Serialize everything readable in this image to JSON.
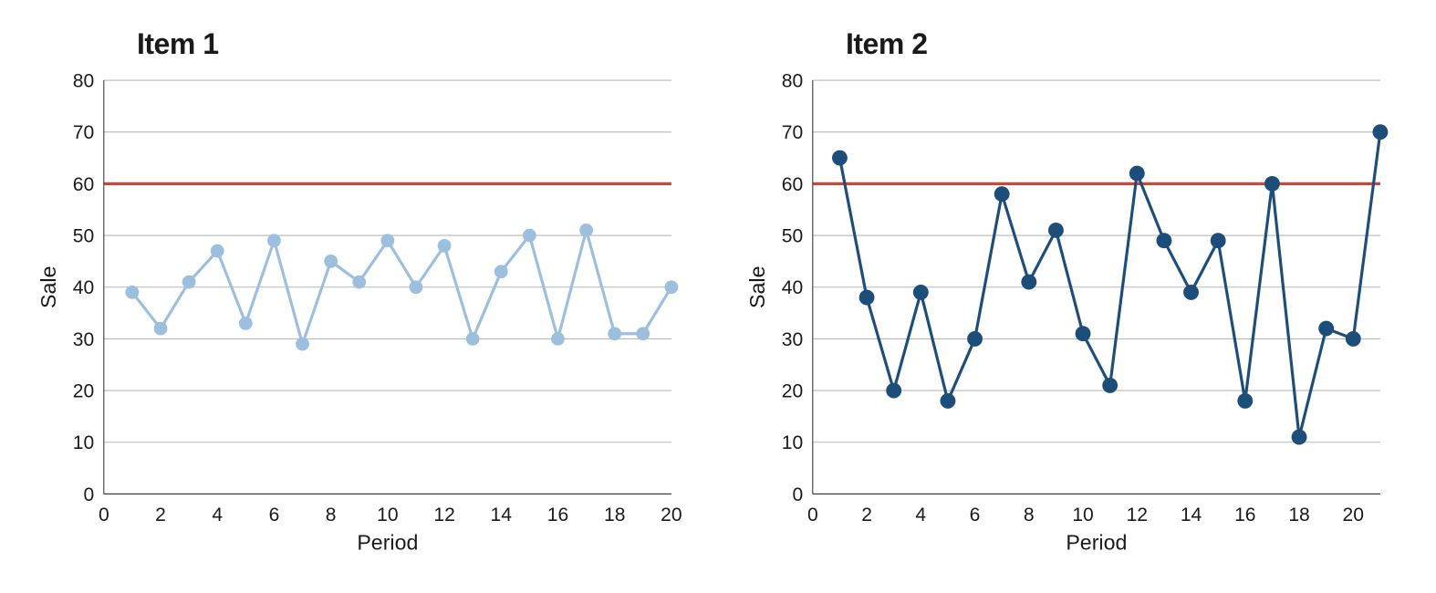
{
  "chart_data": [
    {
      "type": "line",
      "title": "Item 1",
      "xlabel": "Period",
      "ylabel": "Sale",
      "xlim": [
        0,
        20
      ],
      "ylim": [
        0,
        80
      ],
      "x_ticks": [
        0,
        2,
        4,
        6,
        8,
        10,
        12,
        14,
        16,
        18,
        20
      ],
      "y_ticks": [
        0,
        10,
        20,
        30,
        40,
        50,
        60,
        70,
        80
      ],
      "reference_line": 60,
      "reference_color": "#c8493b",
      "line_color": "#9dbfde",
      "marker_color": "#9dbfde",
      "line_width": 3,
      "marker_radius": 7,
      "series": [
        {
          "name": "Item 1",
          "x": [
            1,
            2,
            3,
            4,
            5,
            6,
            7,
            8,
            9,
            10,
            11,
            12,
            13,
            14,
            15,
            16,
            17,
            18,
            19,
            20
          ],
          "values": [
            39,
            32,
            41,
            47,
            33,
            49,
            29,
            45,
            41,
            49,
            40,
            48,
            30,
            43,
            50,
            30,
            51,
            31,
            31,
            40
          ]
        }
      ]
    },
    {
      "type": "line",
      "title": "Item 2",
      "xlabel": "Period",
      "ylabel": "Sale",
      "xlim": [
        0,
        21
      ],
      "ylim": [
        0,
        80
      ],
      "x_ticks": [
        0,
        2,
        4,
        6,
        8,
        10,
        12,
        14,
        16,
        18,
        20
      ],
      "y_ticks": [
        0,
        10,
        20,
        30,
        40,
        50,
        60,
        70,
        80
      ],
      "reference_line": 60,
      "reference_color": "#c8493b",
      "line_color": "#1d4e79",
      "marker_color": "#1d4e79",
      "line_width": 3,
      "marker_radius": 8,
      "series": [
        {
          "name": "Item 2",
          "x": [
            1,
            2,
            3,
            4,
            5,
            6,
            7,
            8,
            9,
            10,
            11,
            12,
            13,
            14,
            15,
            16,
            17,
            18,
            19,
            20,
            21
          ],
          "values": [
            65,
            38,
            20,
            39,
            18,
            30,
            58,
            41,
            51,
            31,
            21,
            62,
            49,
            39,
            49,
            18,
            60,
            11,
            32,
            30,
            70
          ]
        }
      ]
    }
  ]
}
